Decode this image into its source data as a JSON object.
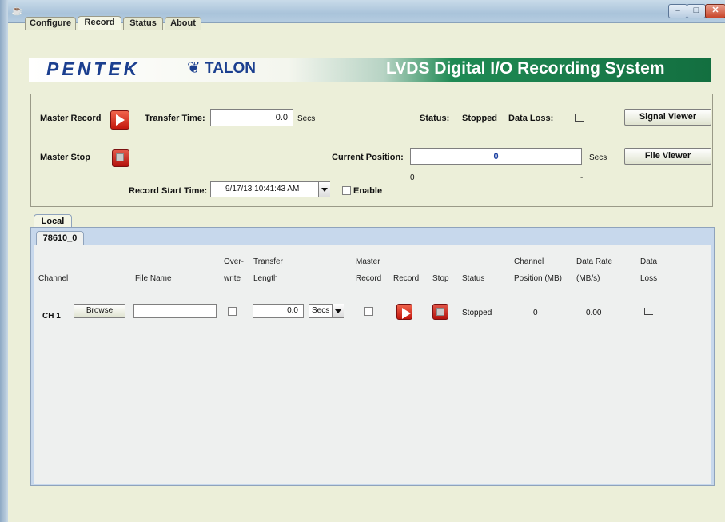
{
  "window": {
    "icon": "java-icon"
  },
  "tabs": [
    "Configure",
    "Record",
    "Status",
    "About"
  ],
  "banner": {
    "brand": "PENTEK",
    "product": "TALON",
    "title": "LVDS Digital I/O Recording System"
  },
  "controls": {
    "master_record_label": "Master Record",
    "master_stop_label": "Master Stop",
    "transfer_time_label": "Transfer Time:",
    "transfer_time_value": "0.0",
    "transfer_time_unit": "Secs",
    "status_label": "Status:",
    "status_value": "Stopped",
    "data_loss_label": "Data Loss:",
    "signal_viewer_label": "Signal Viewer",
    "current_position_label": "Current Position:",
    "current_position_value": "0",
    "current_position_unit": "Secs",
    "file_viewer_label": "File Viewer",
    "range_min": "0",
    "range_max": "-",
    "record_start_time_label": "Record Start Time:",
    "record_start_time_value": "9/17/13 10:41:43 AM",
    "enable_label": "Enable"
  },
  "local": {
    "tab_label": "Local",
    "subtab_label": "78610_0",
    "headers": {
      "channel": "Channel",
      "file_name": "File Name",
      "overwrite_1": "Over-",
      "overwrite_2": "write",
      "transfer_1": "Transfer",
      "transfer_2": "Length",
      "master_1": "Master",
      "master_2": "Record",
      "record": "Record",
      "stop": "Stop",
      "status": "Status",
      "chpos_1": "Channel",
      "chpos_2": "Position (MB)",
      "rate_1": "Data Rate",
      "rate_2": "(MB/s)",
      "loss_1": "Data",
      "loss_2": "Loss"
    },
    "rows": [
      {
        "channel": "CH 1",
        "browse_label": "Browse",
        "file_name": "",
        "transfer_length": "0.0",
        "unit": "Secs",
        "status": "Stopped",
        "position": "0",
        "rate": "0.00"
      }
    ]
  }
}
